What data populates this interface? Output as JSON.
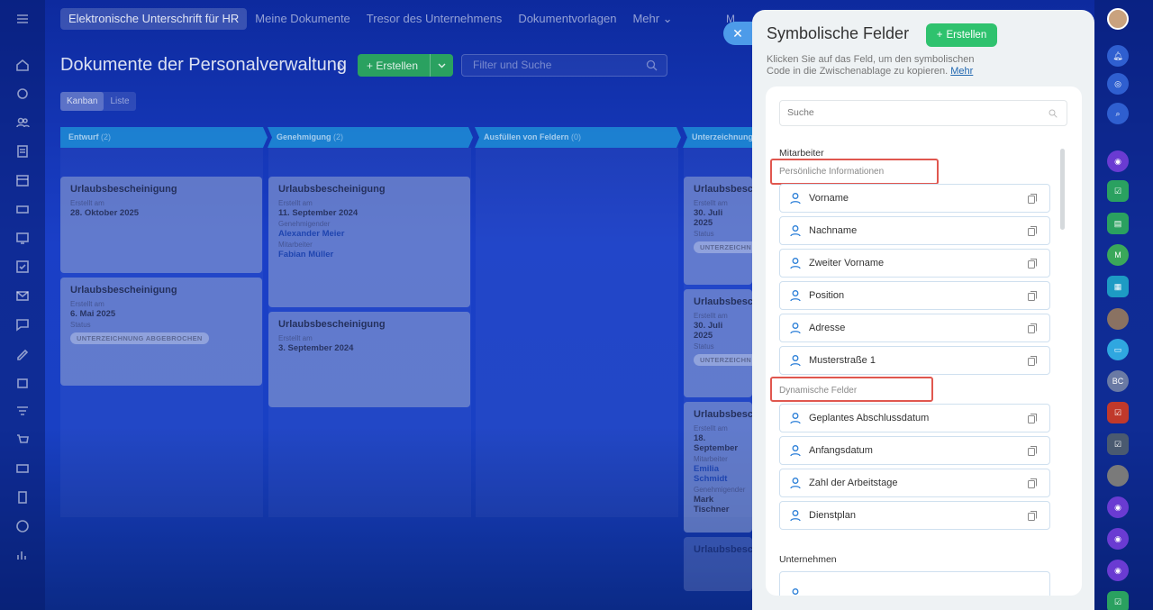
{
  "topnav": {
    "tabs": [
      "Elektronische Unterschrift für HR",
      "Meine Dokumente",
      "Tresor des Unternehmens",
      "Dokumentvorlagen",
      "Mehr ⌄"
    ],
    "active": 0,
    "search_hint": "M"
  },
  "page": {
    "title": "Dokumente der Personalverwaltung",
    "create_label": "+ Erstellen",
    "filter_placeholder": "Filter und Suche",
    "views": [
      "Kanban",
      "Liste"
    ]
  },
  "kanban": {
    "columns": [
      {
        "name": "Entwurf",
        "count": "(2)"
      },
      {
        "name": "Genehmigung",
        "count": "(2)"
      },
      {
        "name": "Ausfüllen von Feldern",
        "count": "(0)"
      },
      {
        "name": "Unterzeichnung",
        "count": ""
      }
    ],
    "cards": [
      {
        "title": "Urlaubsbescheinigung",
        "l1": "Erstellt am",
        "v1": "28. Oktober 2025"
      },
      {
        "title": "Urlaubsbescheinigung",
        "l1": "Erstellt am",
        "v1": "6. Mai 2025",
        "l2": "Status",
        "badge": "UNTERZEICHNUNG ABGEBROCHEN"
      },
      {
        "title": "Urlaubsbescheinigung",
        "l1": "Erstellt am",
        "v1": "11. September 2024",
        "l2": "Genehmigender",
        "v2": "Alexander Meier",
        "l3": "Mitarbeiter",
        "v3": "Fabian Müller"
      },
      {
        "title": "Urlaubsbescheinigung",
        "l1": "Erstellt am",
        "v1": "3. September 2024"
      },
      {
        "title": "Urlaubsbesch",
        "l1": "Erstellt am",
        "v1": "30. Juli 2025",
        "l2": "Status",
        "badge": "UNTERZEICHN"
      },
      {
        "title": "Urlaubsbesch",
        "l1": "Erstellt am",
        "v1": "30. Juli 2025",
        "l2": "Status",
        "badge": "UNTERZEICHN"
      },
      {
        "title": "Urlaubsbesch",
        "l1": "Erstellt am",
        "v1": "18. September",
        "l2": "Mitarbeiter",
        "v2": "Emilia Schmidt",
        "l3": "Genehmigender",
        "v3": "Mark Tischner"
      },
      {
        "title": "Urlaubsbesche"
      }
    ]
  },
  "panel": {
    "title": "Symbolische Felder",
    "create_label": "Erstellen",
    "desc": "Klicken Sie auf das Feld, um den symbolischen Code in die Zwischenablage zu kopieren.",
    "more": "Mehr",
    "search_placeholder": "Suche",
    "groups": [
      {
        "title": "Mitarbeiter",
        "subgroups": [
          {
            "title": "Persönliche Informationen",
            "fields": [
              "Vorname",
              "Nachname",
              "Zweiter Vorname",
              "Position",
              "Adresse",
              "Musterstraße 1"
            ]
          },
          {
            "title": "Dynamische Felder",
            "fields": [
              "Geplantes Abschlussdatum",
              "Anfangsdatum",
              "Zahl der Arbeitstage",
              "Dienstplan"
            ]
          }
        ]
      },
      {
        "title": "Unternehmen"
      }
    ]
  },
  "right_rail": {
    "items": [
      {
        "icon": "avatar-icon",
        "color": "#c9a27e"
      },
      {
        "icon": "bell-icon",
        "color": "#2f5fd0"
      },
      {
        "icon": "target-icon",
        "color": "#2f5fd0"
      },
      {
        "icon": "chat-search-icon",
        "color": "#2f5fd0"
      },
      {
        "icon": "copilot-icon",
        "color": "#6a3bd2"
      },
      {
        "icon": "task-icon",
        "color": "#2aa160"
      },
      {
        "icon": "contact-icon",
        "color": "#2aa160"
      },
      {
        "icon": "letter-m",
        "text": "M",
        "color": "#3aa85a"
      },
      {
        "icon": "calendar-icon",
        "color": "#1d9bc4"
      },
      {
        "icon": "avatar-icon",
        "color": "#8a7262"
      },
      {
        "icon": "chat-icon",
        "color": "#2fa7e0"
      },
      {
        "icon": "letter-bc",
        "text": "BC",
        "color": "#6a7aa4"
      },
      {
        "icon": "task-icon",
        "color": "#c0392b"
      },
      {
        "icon": "task-icon",
        "color": "#4a5a70"
      },
      {
        "icon": "avatar-icon",
        "color": "#7a7a7a"
      },
      {
        "icon": "copilot-icon",
        "color": "#6a3bd2"
      },
      {
        "icon": "copilot-icon",
        "color": "#6a3bd2"
      },
      {
        "icon": "copilot-icon",
        "color": "#6a3bd2"
      },
      {
        "icon": "task-icon",
        "color": "#2aa160"
      }
    ]
  }
}
